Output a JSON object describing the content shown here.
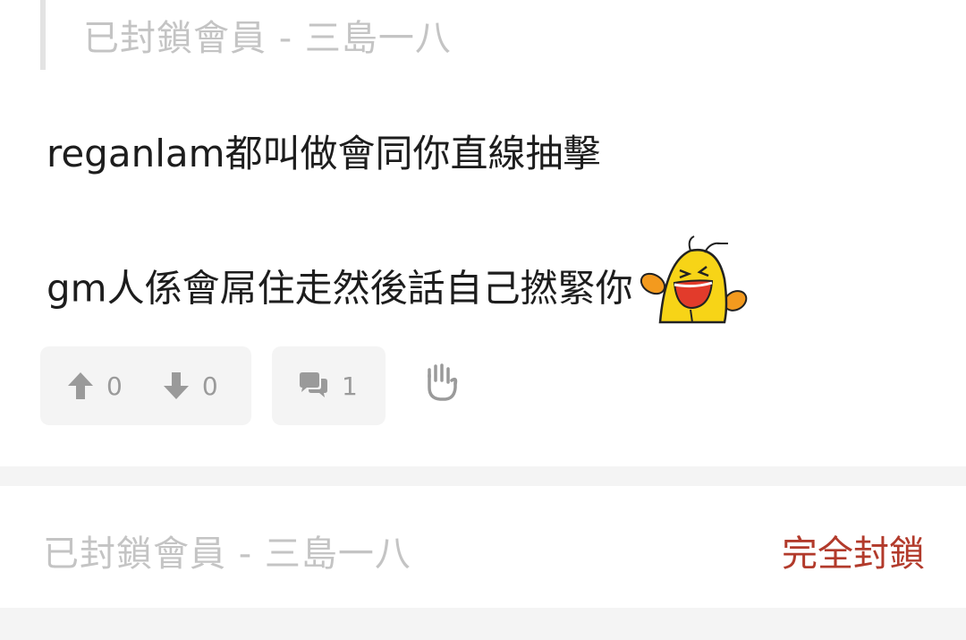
{
  "quote": {
    "author": "已封鎖會員 - 三島一八"
  },
  "post": {
    "line1": "reganlam都叫做會同你直線抽擊",
    "line2": "gm人係會屌住走然後話自己撚緊你",
    "sticker": "laughing-cat-sticker"
  },
  "actions": {
    "upvotes": "0",
    "downvotes": "0",
    "replies": "1",
    "upvote_icon": "arrow-up-icon",
    "downvote_icon": "arrow-down-icon",
    "reply_icon": "comments-icon",
    "report_icon": "hand-report-icon"
  },
  "next_item": {
    "author": "已封鎖會員 - 三島一八",
    "block_label": "完全封鎖"
  },
  "colors": {
    "text": "#1d1d1d",
    "muted": "#c4c4c4",
    "count": "#9a9a9a",
    "pill_bg": "#f4f4f4",
    "block_red": "#b23a2b",
    "sticker_yellow": "#f7d417",
    "sticker_orange": "#f39a1e"
  }
}
